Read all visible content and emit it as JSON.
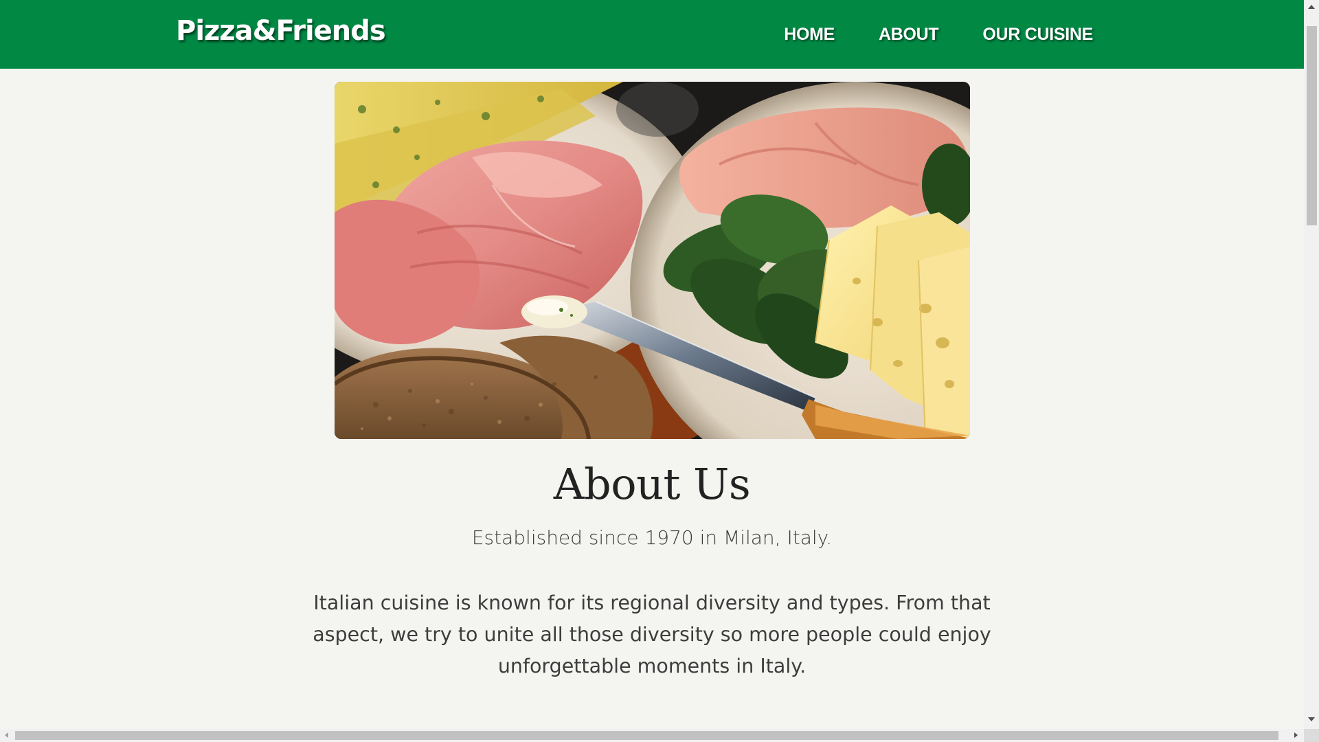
{
  "navbar": {
    "brand": "Pizza&Friends",
    "links": [
      "HOME",
      "ABOUT",
      "OUR CUISINE"
    ],
    "background_color": "#018944"
  },
  "hero": {
    "image_subject": "cold-cuts-platter-icon"
  },
  "about": {
    "title": "About Us",
    "established": "Established since 1970 in Milan, Italy.",
    "description": "Italian cuisine is known for its regional diversity and types. From that aspect, we try to unite all those diversity so more people could enjoy unforgettable moments in Italy."
  },
  "colors": {
    "page_background": "#f4f4f1",
    "text": "#222222"
  }
}
